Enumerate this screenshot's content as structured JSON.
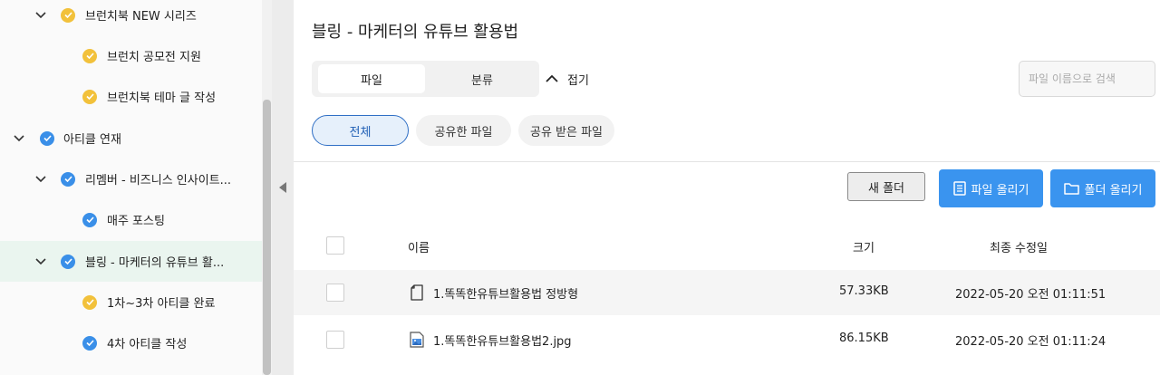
{
  "sidebar": {
    "items": [
      {
        "label": "브런치북 NEW 시리즈",
        "status": "yellow",
        "expanded": true
      },
      {
        "label": "브런치 공모전 지원",
        "status": "yellow"
      },
      {
        "label": "브런치북 테마 글 작성",
        "status": "yellow"
      },
      {
        "label": "아티클 연재",
        "status": "blue",
        "expanded": true
      },
      {
        "label": "리멤버 - 비즈니스 인사이트...",
        "status": "blue",
        "expanded": true
      },
      {
        "label": "매주 포스팅",
        "status": "blue"
      },
      {
        "label": "블링 - 마케터의 유튜브 활...",
        "status": "blue",
        "expanded": true,
        "selected": true
      },
      {
        "label": "1차~3차 아티클 완료",
        "status": "yellow"
      },
      {
        "label": "4차 아티클 작성",
        "status": "blue"
      }
    ]
  },
  "main": {
    "title": "블링 - 마케터의 유튜브 활용법",
    "view_tabs": [
      "파일",
      "분류"
    ],
    "active_view": "파일",
    "fold_label": "접기",
    "search": {
      "placeholder": "파일 이름으로 검색",
      "value": ""
    },
    "filters": [
      "전체",
      "공유한 파일",
      "공유 받은 파일"
    ],
    "active_filter": "전체",
    "actions": {
      "new_folder": "새 폴더",
      "upload_file": "파일 올리기",
      "upload_folder": "폴더 올리기"
    },
    "table": {
      "columns": [
        "이름",
        "크기",
        "최종 수정일"
      ],
      "rows": [
        {
          "name": "1.똑똑한유튜브활용법 정방형",
          "size": "57.33KB",
          "modified": "2022-05-20 오전 01:11:51",
          "icon": "document-icon"
        },
        {
          "name": "1.똑똑한유튜브활용법2.jpg",
          "size": "86.15KB",
          "modified": "2022-05-20 오전 01:11:24",
          "icon": "image-file-icon"
        }
      ]
    }
  },
  "colors": {
    "yellow": "#f2c13b",
    "blue": "#3a8fe8",
    "accent": "#3a94ef",
    "selected_row": "#eaf5ef"
  }
}
